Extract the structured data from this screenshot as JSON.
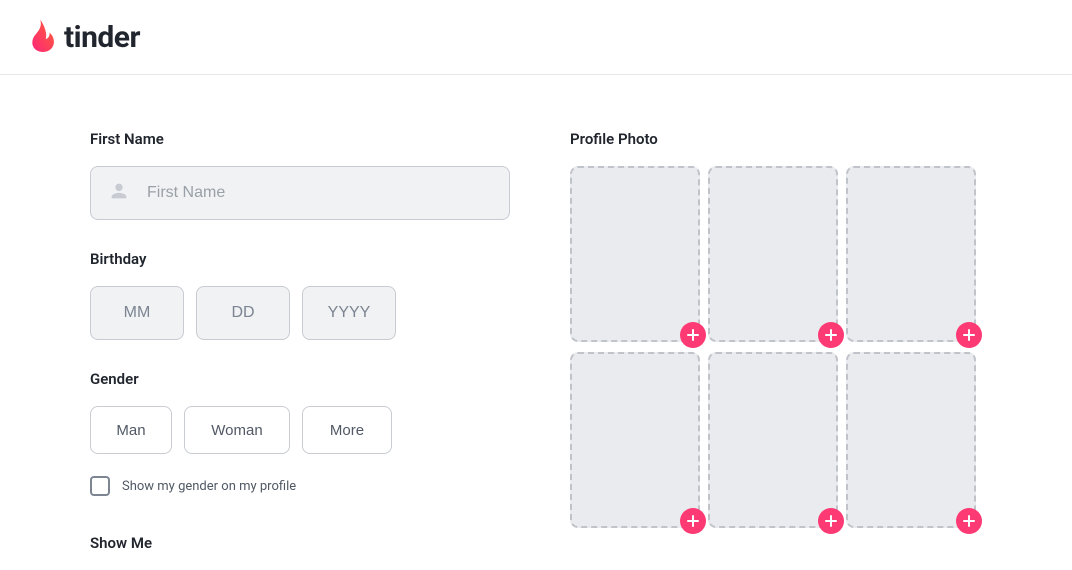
{
  "brand": {
    "name": "tinder",
    "flame_gradient_start": "#fd267a",
    "flame_gradient_end": "#ff6036"
  },
  "form": {
    "first_name": {
      "label": "First Name",
      "placeholder": "First Name",
      "value": ""
    },
    "birthday": {
      "label": "Birthday",
      "mm_placeholder": "MM",
      "dd_placeholder": "DD",
      "yyyy_placeholder": "YYYY",
      "mm_value": "",
      "dd_value": "",
      "yyyy_value": ""
    },
    "gender": {
      "label": "Gender",
      "options": [
        "Man",
        "Woman",
        "More"
      ],
      "show_on_profile_label": "Show my gender on my profile",
      "show_on_profile_checked": false
    },
    "show_me": {
      "label": "Show Me"
    }
  },
  "photos": {
    "label": "Profile Photo",
    "slots": 6
  },
  "colors": {
    "accent": "#fd3a73",
    "text_primary": "#21262e",
    "text_secondary": "#505965",
    "border": "#c8ccd2",
    "input_bg": "#f0f2f4"
  }
}
